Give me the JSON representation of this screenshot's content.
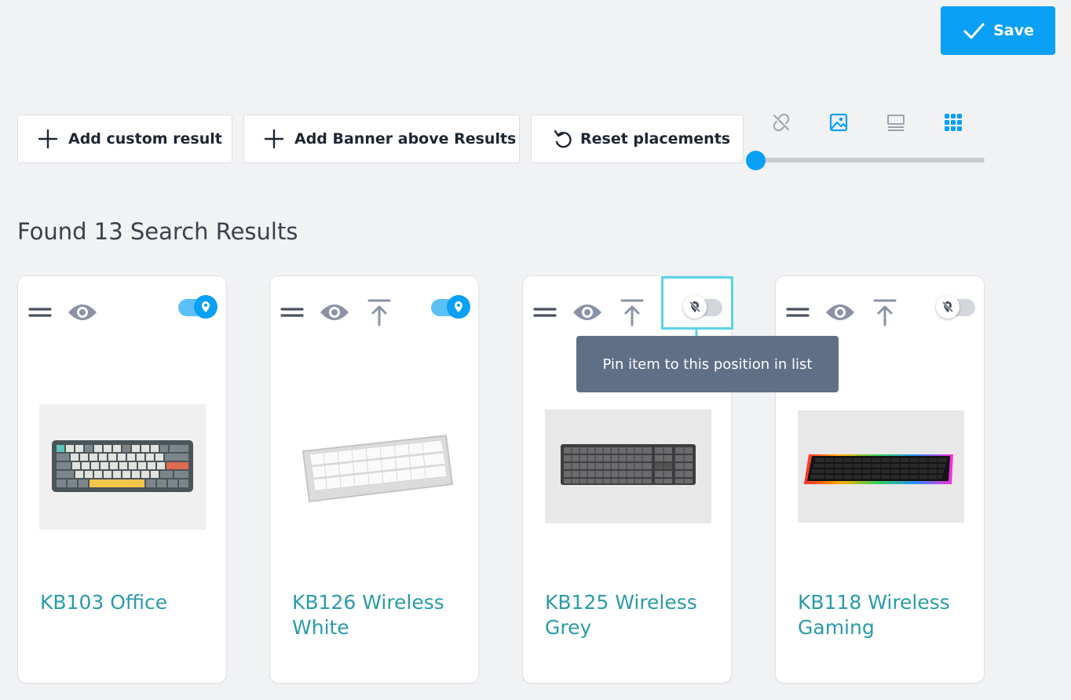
{
  "toolbar": {
    "save_label": "Save",
    "add_custom_label": "Add custom result",
    "add_banner_label": "Add Banner above Results",
    "reset_label": "Reset placements"
  },
  "view_icons": [
    "link-off-icon",
    "image-icon",
    "list-view-icon",
    "grid-view-icon"
  ],
  "slider": {
    "value_fraction": 0.0
  },
  "results": {
    "title": "Found 13 Search Results",
    "tooltip": "Pin item to this position in list",
    "items": [
      {
        "name": "KB103 Office",
        "pinned": true
      },
      {
        "name": "KB126 Wireless White",
        "pinned": true
      },
      {
        "name": "KB125 Wireless Grey",
        "pinned": false
      },
      {
        "name": "KB118 Wireless Gaming",
        "pinned": false
      }
    ]
  },
  "colors": {
    "accent": "#0aa0f5",
    "link": "#2a9baa",
    "tooltip_bg": "#5f6f85",
    "highlight": "#5bd3e6"
  }
}
